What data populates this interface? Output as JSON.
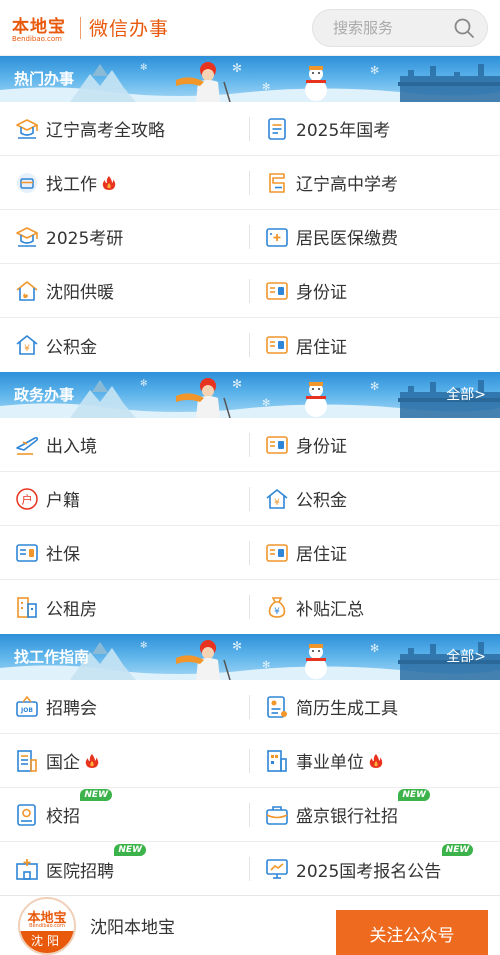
{
  "header": {
    "logo_main": "本地宝",
    "logo_sub": "Bendibao.com",
    "title": "微信办事",
    "search_placeholder": "搜索服务"
  },
  "sections": [
    {
      "title": "热门办事",
      "more": "",
      "items": [
        {
          "label": "辽宁高考全攻略",
          "icon": "graduation-cap-icon",
          "hot": false,
          "new": false
        },
        {
          "label": "2025年国考",
          "icon": "exam-document-icon",
          "hot": false,
          "new": false
        },
        {
          "label": "找工作",
          "icon": "job-card-icon",
          "hot": true,
          "new": false
        },
        {
          "label": "辽宁高中学考",
          "icon": "exam-paper-icon",
          "hot": false,
          "new": false
        },
        {
          "label": "2025考研",
          "icon": "graduation-cap-icon",
          "hot": false,
          "new": false
        },
        {
          "label": "居民医保缴费",
          "icon": "medical-insurance-icon",
          "hot": false,
          "new": false
        },
        {
          "label": "沈阳供暖",
          "icon": "house-heating-icon",
          "hot": false,
          "new": false
        },
        {
          "label": "身份证",
          "icon": "id-card-icon",
          "hot": false,
          "new": false
        },
        {
          "label": "公积金",
          "icon": "house-fund-icon",
          "hot": false,
          "new": false
        },
        {
          "label": "居住证",
          "icon": "id-card-icon",
          "hot": false,
          "new": false
        }
      ]
    },
    {
      "title": "政务办事",
      "more": "全部>",
      "items": [
        {
          "label": "出入境",
          "icon": "airplane-icon",
          "hot": false,
          "new": false
        },
        {
          "label": "身份证",
          "icon": "id-card-icon",
          "hot": false,
          "new": false
        },
        {
          "label": "户籍",
          "icon": "household-register-icon",
          "hot": false,
          "new": false
        },
        {
          "label": "公积金",
          "icon": "house-fund-icon",
          "hot": false,
          "new": false
        },
        {
          "label": "社保",
          "icon": "social-security-card-icon",
          "hot": false,
          "new": false
        },
        {
          "label": "居住证",
          "icon": "id-card-icon",
          "hot": false,
          "new": false
        },
        {
          "label": "公租房",
          "icon": "building-icon",
          "hot": false,
          "new": false
        },
        {
          "label": "补贴汇总",
          "icon": "money-bag-icon",
          "hot": false,
          "new": false
        }
      ]
    },
    {
      "title": "找工作指南",
      "more": "全部>",
      "items": [
        {
          "label": "招聘会",
          "icon": "job-fair-icon",
          "hot": false,
          "new": false
        },
        {
          "label": "简历生成工具",
          "icon": "resume-icon",
          "hot": false,
          "new": false
        },
        {
          "label": "国企",
          "icon": "company-building-icon",
          "hot": true,
          "new": false
        },
        {
          "label": "事业单位",
          "icon": "office-building-icon",
          "hot": true,
          "new": false
        },
        {
          "label": "校招",
          "icon": "campus-recruit-icon",
          "hot": false,
          "new": true
        },
        {
          "label": "盛京银行社招",
          "icon": "bank-briefcase-icon",
          "hot": false,
          "new": true
        },
        {
          "label": "医院招聘",
          "icon": "hospital-icon",
          "hot": false,
          "new": true
        },
        {
          "label": "2025国考报名公告",
          "icon": "monitor-icon",
          "hot": false,
          "new": true
        }
      ]
    }
  ],
  "new_tag": "NEW",
  "footer": {
    "avatar_main": "本地宝",
    "avatar_sub": "Bendibao.com",
    "avatar_city": "沈阳",
    "account_name": "沈阳本地宝",
    "follow_button": "关注公众号"
  },
  "colors": {
    "brand": "#e8590c",
    "icon_blue": "#2f86d6",
    "icon_orange": "#f0962b",
    "new_green": "#3cb34a",
    "hot_red": "#e8331f",
    "button": "#ee6a1f"
  }
}
